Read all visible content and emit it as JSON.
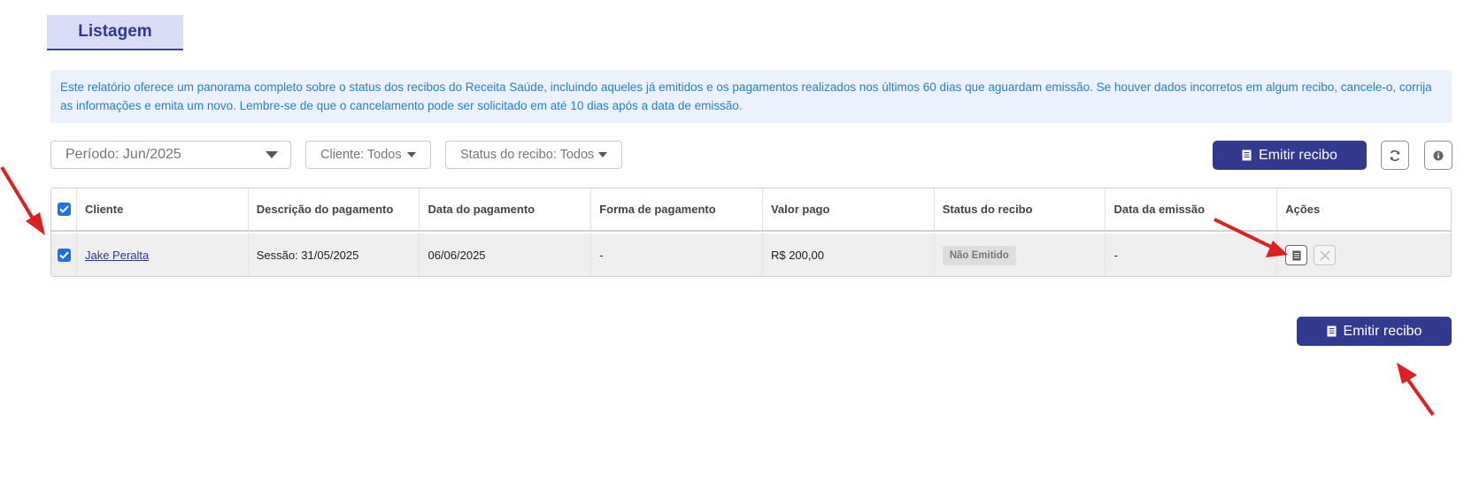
{
  "tab": {
    "label": "Listagem"
  },
  "info": {
    "text": "Este relatório oferece um panorama completo sobre o status dos recibos do Receita Saúde, incluindo aqueles já emitidos e os pagamentos realizados nos últimos 60 dias que aguardam emissão. Se houver dados incorretos em algum recibo, cancele-o, corrija as informações e emita um novo. Lembre-se de que o cancelamento pode ser solicitado em até 10 dias após a data de emissão."
  },
  "filters": {
    "period": "Período: Jun/2025",
    "client": "Cliente: Todos",
    "status": "Status do recibo: Todos"
  },
  "toolbar": {
    "emit_label": "Emitir recibo",
    "refresh_icon": "refresh-icon",
    "info_icon": "info-icon"
  },
  "table": {
    "headers": [
      "Cliente",
      "Descrição do pagamento",
      "Data do pagamento",
      "Forma de pagamento",
      "Valor pago",
      "Status do recibo",
      "Data da emissão",
      "Ações"
    ],
    "rows": [
      {
        "selected": true,
        "client": "Jake Peralta",
        "description": "Sessão: 31/05/2025",
        "payment_date": "06/06/2025",
        "payment_method": "-",
        "amount": "R$ 200,00",
        "status": "Não Emitido",
        "issue_date": "-"
      }
    ]
  },
  "footer": {
    "emit_label": "Emitir recibo"
  },
  "colors": {
    "primary": "#323a8f",
    "info_bg": "#eaf3fd",
    "info_text": "#2a7fc9",
    "annotation_arrow": "#e02020"
  }
}
